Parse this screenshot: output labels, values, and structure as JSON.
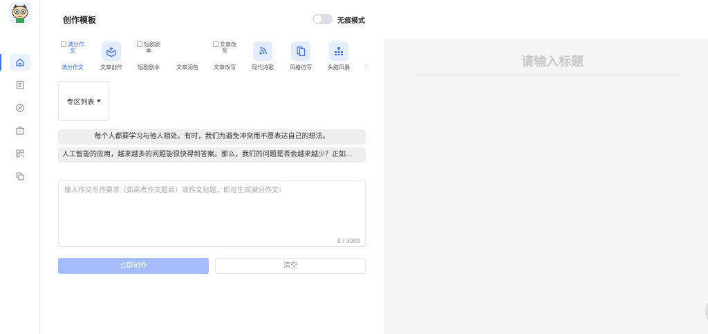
{
  "header": {
    "title": "创作模板",
    "toggle_label": "无痕模式"
  },
  "templates": [
    {
      "label": "满分作文",
      "broken_text": [
        "满分作",
        "文"
      ]
    },
    {
      "label": "文章创作",
      "icon": "open-box-icon"
    },
    {
      "label": "短剧剧本",
      "broken_text": [
        "短剧剧",
        "本"
      ]
    },
    {
      "label": "文章润色"
    },
    {
      "label": "文章改写",
      "broken_text": [
        "文章改",
        "写"
      ]
    },
    {
      "label": "现代诗歌",
      "icon": "signal-wave-icon"
    },
    {
      "label": "风格仿写",
      "icon": "copy-doc-icon"
    },
    {
      "label": "头脑风暴",
      "icon": "group-people-icon"
    }
  ],
  "more_indicator": ":",
  "zone": {
    "label": "专区列表"
  },
  "suggestions": [
    "每个人都要学习与他人相处。有时，我们为避免冲突而不愿表达自己的想法。",
    "人工智能的应用，越来越多的问题能很快得到答案。那么，我们的问题是否会越来越少？正如..."
  ],
  "input": {
    "placeholder": "输入作文写作要求（如高考作文题目）或作文标题，即可生成满分作文!",
    "counter": "0 / 3000"
  },
  "buttons": {
    "create": "立即创作",
    "clear": "清空"
  },
  "preview": {
    "title_placeholder": "请输入标题"
  },
  "colors": {
    "accent": "#3b6ff5",
    "primary_button": "#a4bcfb",
    "preview_bg": "#f5f5f5"
  }
}
